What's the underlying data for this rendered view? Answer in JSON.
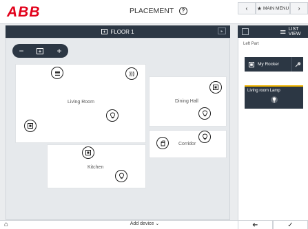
{
  "header": {
    "logo": [
      "A",
      "B",
      "B"
    ],
    "title": "PLACEMENT",
    "help_icon": "?",
    "back_glyph": "‹",
    "main_menu_label": "MAIN MENU",
    "main_menu_icon": "★",
    "forward_glyph": "›"
  },
  "floor": {
    "name": "FLOOR 1",
    "next_glyph": "▸",
    "zoom": {
      "minus": "−",
      "plus": "+"
    }
  },
  "rooms": [
    {
      "label": "Living Room"
    },
    {
      "label": "Dining Hall"
    },
    {
      "label": "Corridor"
    },
    {
      "label": "Kitchen"
    }
  ],
  "footer": {
    "add_device": "Add device ⌄",
    "home_glyph": "⌂"
  },
  "right_panel": {
    "view_label": "LIST VIEW",
    "section_label": "Left Part",
    "items": [
      {
        "label": "My Rocker"
      },
      {
        "label": "Living room Lamp"
      }
    ],
    "back_glyph": "➜",
    "confirm_glyph": "✓"
  },
  "colors": {
    "accent": "#e2001a",
    "dark": "#2c3744",
    "highlight": "#f0b400"
  }
}
